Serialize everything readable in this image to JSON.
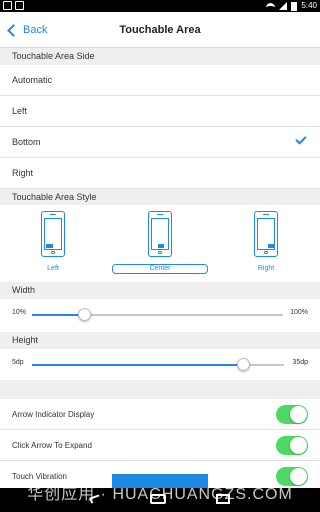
{
  "status_bar": {
    "time": "5:40",
    "left_icons": [
      "notification-icon",
      "image-icon",
      "mail-icon"
    ],
    "right_icons": [
      "wifi-icon",
      "signal-icon",
      "battery-icon"
    ]
  },
  "nav": {
    "back_label": "Back",
    "title": "Touchable Area"
  },
  "side_section": {
    "header": "Touchable Area Side",
    "options": [
      {
        "label": "Automatic",
        "selected": false
      },
      {
        "label": "Left",
        "selected": false
      },
      {
        "label": "Bottom",
        "selected": true
      },
      {
        "label": "Right",
        "selected": false
      }
    ]
  },
  "style_section": {
    "header": "Touchable Area Style",
    "options": [
      {
        "label": "Left",
        "selected": false
      },
      {
        "label": "Center",
        "selected": true
      },
      {
        "label": "Right",
        "selected": false
      }
    ]
  },
  "width_section": {
    "header": "Width",
    "min_label": "10%",
    "max_label": "100%",
    "value_fraction": 0.21
  },
  "height_section": {
    "header": "Height",
    "min_label": "5dp",
    "max_label": "35dp",
    "value_fraction": 0.84
  },
  "toggles": [
    {
      "label": "Arrow Indicator Display",
      "on": true
    },
    {
      "label": "Click Arrow To Expand",
      "on": true
    },
    {
      "label": "Touch Vibration",
      "on": true
    }
  ],
  "watermark": "华创应用 · HUACHUANGZS.COM",
  "colors": {
    "accent": "#1d8ae3",
    "toggle_on": "#4cd964",
    "section_bg": "#efefef"
  }
}
